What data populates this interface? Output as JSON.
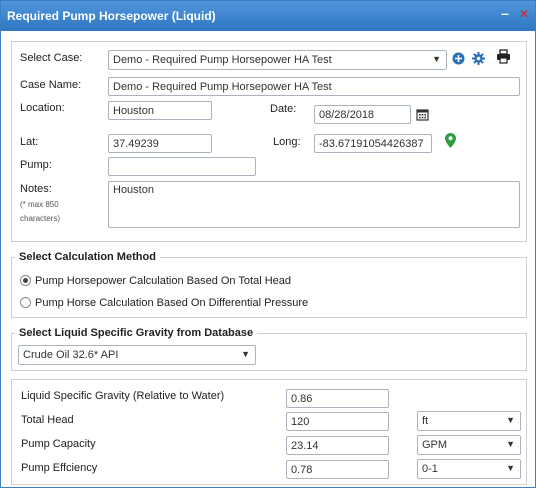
{
  "window": {
    "title": "Required Pump Horsepower (Liquid)",
    "minimize_glyph": "–",
    "close_glyph": "✕"
  },
  "case": {
    "select_case_label": "Select Case:",
    "select_case_value": "Demo - Required Pump Horsepower HA Test",
    "case_name_label": "Case Name:",
    "case_name_value": "Demo - Required Pump Horsepower HA Test",
    "location_label": "Location:",
    "location_value": "Houston",
    "date_label": "Date:",
    "date_value": "08/28/2018",
    "lat_label": "Lat:",
    "lat_value": "37.49239",
    "long_label": "Long:",
    "long_value": "-83.67191054426387",
    "pump_label": "Pump:",
    "pump_value": "",
    "notes_label": "Notes:",
    "notes_hint": "(* max 850 characters)",
    "notes_value": "Houston",
    "icons": [
      "plus-circle-icon",
      "gear-icon",
      "printer-icon",
      "calendar-icon",
      "map-marker-icon"
    ],
    "accent_color": "#2a6fb8",
    "marker_color": "#2e9d3e"
  },
  "calc_method": {
    "legend": "Select Calculation Method",
    "options": [
      {
        "label": "Pump Horsepower Calculation Based On Total Head",
        "checked": true
      },
      {
        "label": "Pump Horse Calculation Based On Differential Pressure",
        "checked": false
      }
    ]
  },
  "gravity_db": {
    "legend": "Select Liquid Specific Gravity from Database",
    "selected": "Crude Oil 32.6* API"
  },
  "inputs": {
    "sg_label": "Liquid Specific Gravity (Relative to Water)",
    "sg_value": "0.86",
    "total_head_label": "Total Head",
    "total_head_value": "120",
    "total_head_unit": "ft",
    "capacity_label": "Pump Capacity",
    "capacity_value": "23.14",
    "capacity_unit": "GPM",
    "efficiency_label": "Pump Effciency",
    "efficiency_value": "0.78",
    "efficiency_unit": "0-1"
  }
}
